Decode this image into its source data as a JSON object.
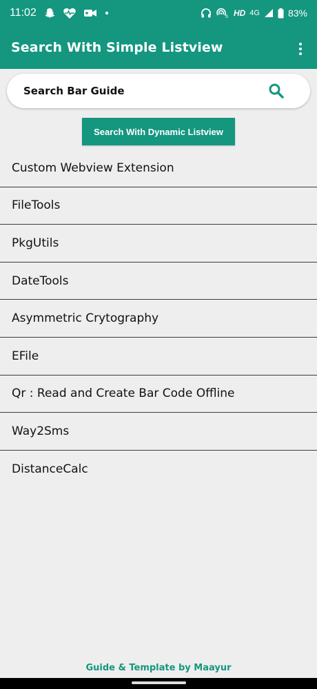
{
  "status_bar": {
    "time": "11:02",
    "network_type": "HD",
    "signal_label": "4G",
    "battery_percent": "83%",
    "icons": [
      "snapchat-icon",
      "heart-pulse-icon",
      "video-camera-icon",
      "dot-icon",
      "headphones-icon",
      "hotspot-icon",
      "signal-icon",
      "battery-icon"
    ]
  },
  "app_bar": {
    "title": "Search With Simple Listview",
    "menu_icon": "overflow-menu-icon"
  },
  "search": {
    "label": "Search Bar Guide",
    "icon": "search-icon"
  },
  "dynamic_button": {
    "label": "Search With Dynamic Listview"
  },
  "list_items": [
    "Custom Webview Extension",
    "FileTools",
    "PkgUtils",
    "DateTools",
    "Asymmetric Crytography",
    "EFile",
    "Qr : Read and Create Bar Code Offline",
    "Way2Sms",
    "DistanceCalc"
  ],
  "footer": {
    "text": "Guide & Template by Maayur"
  },
  "colors": {
    "primary": "#14967f",
    "background": "#eeeeee"
  }
}
